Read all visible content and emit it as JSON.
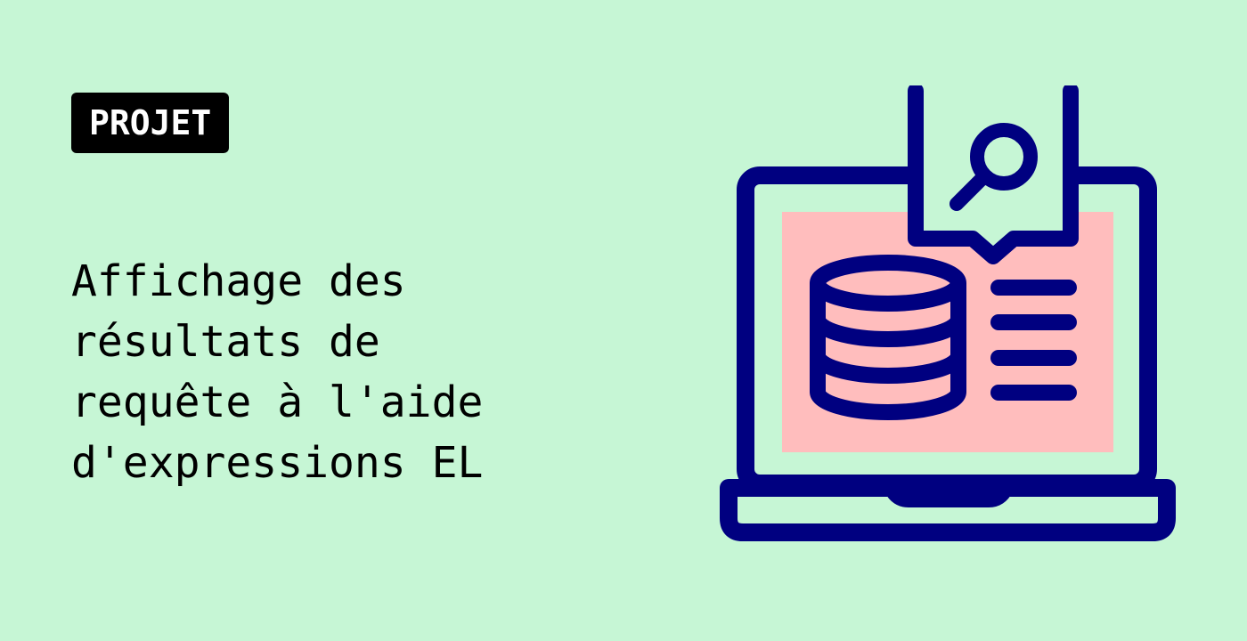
{
  "badge": {
    "label": "PROJET"
  },
  "title": {
    "lines": [
      "Affichage des",
      "résultats de",
      "requête à l'aide",
      "d'expressions EL"
    ]
  },
  "illustration": {
    "icons": [
      "laptop-icon",
      "database-icon",
      "search-icon",
      "list-icon"
    ]
  },
  "colors": {
    "background": "#c6f6d5",
    "badge_background": "#000000",
    "badge_text": "#ffffff",
    "stroke": "#000080",
    "screen_fill": "#ffbdbd",
    "text": "#000000"
  }
}
